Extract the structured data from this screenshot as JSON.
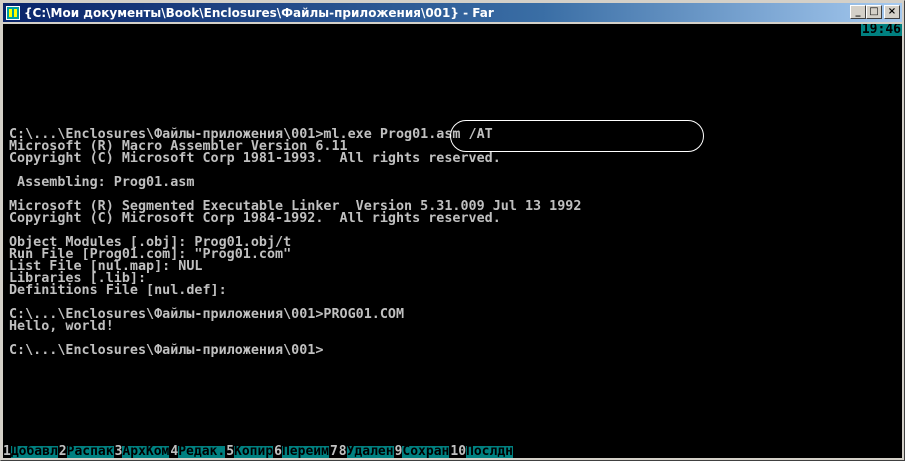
{
  "window": {
    "title": "{C:\\Мои документы\\Book\\Enclosures\\Файлы-приложения\\001} - Far",
    "buttons": {
      "minimize": "_",
      "maximize": "□",
      "close": "×"
    }
  },
  "clock": "19:46",
  "console_lines": [
    "C:\\...\\Enclosures\\Файлы-приложения\\001>ml.exe Prog01.asm /AT",
    "Microsoft (R) Macro Assembler Version 6.11",
    "Copyright (C) Microsoft Corp 1981-1993.  All rights reserved.",
    "",
    " Assembling: Prog01.asm",
    "",
    "Microsoft (R) Segmented Executable Linker  Version 5.31.009 Jul 13 1992",
    "Copyright (C) Microsoft Corp 1984-1992.  All rights reserved.",
    "",
    "Object Modules [.obj]: Prog01.obj/t",
    "Run File [Prog01.com]: \"Prog01.com\"",
    "List File [nul.map]: NUL",
    "Libraries [.lib]:",
    "Definitions File [nul.def]:",
    "",
    "C:\\...\\Enclosures\\Файлы-приложения\\001>PROG01.COM",
    "Hello, world!",
    "",
    "C:\\...\\Enclosures\\Файлы-приложения\\001>"
  ],
  "keybar": [
    {
      "num": "1",
      "label": "Добавл"
    },
    {
      "num": "2",
      "label": "Распак"
    },
    {
      "num": "3",
      "label": "АрхКом"
    },
    {
      "num": "4",
      "label": "Редак. "
    },
    {
      "num": "5",
      "label": "Копир  "
    },
    {
      "num": "6",
      "label": "Переим "
    },
    {
      "num": "7",
      "label": "        "
    },
    {
      "num": "8",
      "label": "Удален "
    },
    {
      "num": "9",
      "label": "Сохран "
    },
    {
      "num": "10",
      "label": "Послдн"
    }
  ],
  "colors": {
    "console_bg": "#000000",
    "console_fg": "#c0c0c0",
    "keybar_label_bg": "#008080",
    "title_gradient_start": "#0a246a"
  }
}
